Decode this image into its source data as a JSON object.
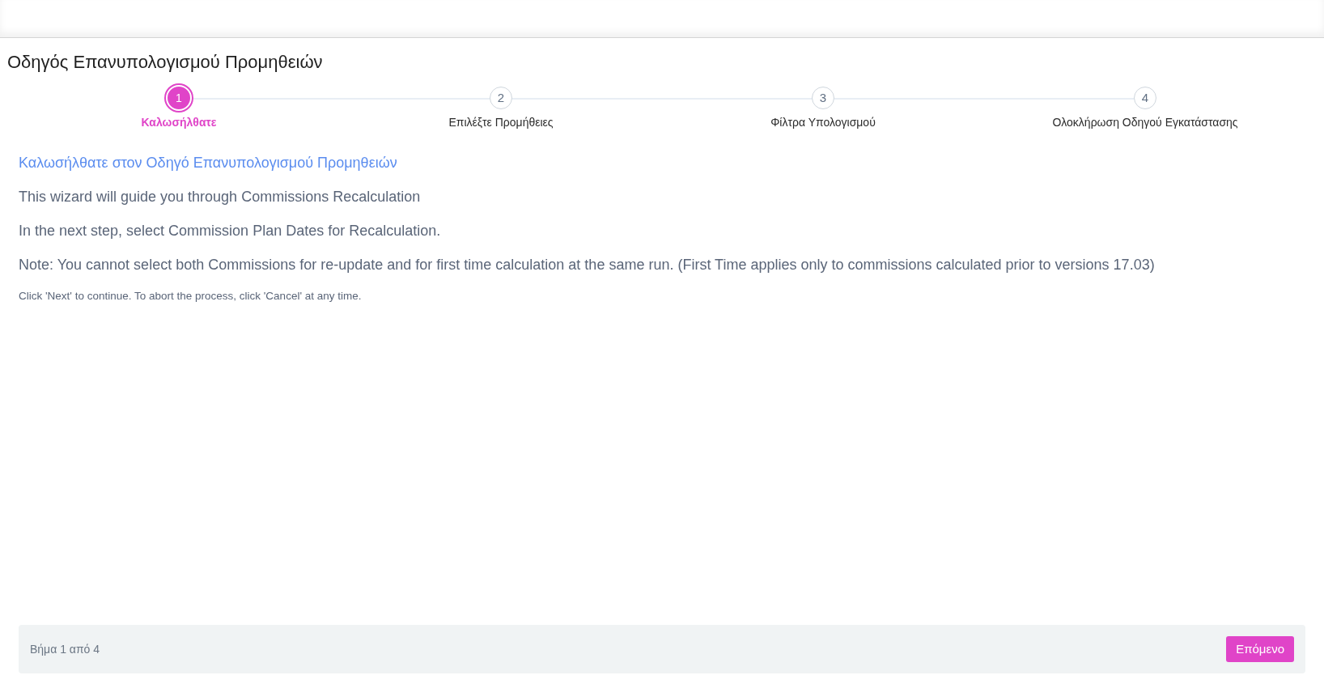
{
  "page_title": "Οδηγός Επανυπολογισμού Προμηθειών",
  "steps": [
    {
      "number": "1",
      "label": "Καλωσήλθατε",
      "selected": true
    },
    {
      "number": "2",
      "label": "Επιλέξτε Προμήθειες",
      "selected": false
    },
    {
      "number": "3",
      "label": "Φίλτρα Υπολογισμού",
      "selected": false
    },
    {
      "number": "4",
      "label": "Ολοκλήρωση Οδηγού Εγκατάστασης",
      "selected": false
    }
  ],
  "content": {
    "heading": "Καλωσήλθατε στον Οδηγό Επανυπολογισμού Προμηθειών",
    "paragraphs": [
      "This wizard will guide you through Commissions Recalculation",
      "In the next step, select Commission Plan Dates for Recalculation.",
      "Note: You cannot select both Commissions for re-update and for first time calculation at the same run. (First Time applies only to commissions calculated prior to versions 17.03)"
    ],
    "hint": "Click 'Next' to continue. To abort the process, click 'Cancel' at any time."
  },
  "footer": {
    "step_counter": "Βήμα 1 από 4",
    "next_button": "Επόμενο"
  }
}
